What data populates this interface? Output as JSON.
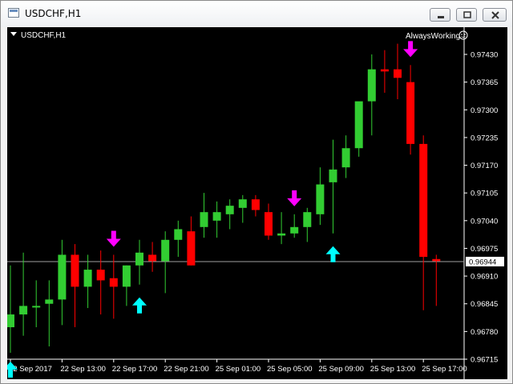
{
  "window": {
    "title": "USDCHF,H1"
  },
  "chart": {
    "symbol_label": "USDCHF,H1",
    "brand_label": "AlwaysWorking"
  },
  "colors": {
    "background": "#000000",
    "bull": "#32cd32",
    "bear": "#ff0000",
    "sell_arrow": "#ff00ff",
    "buy_arrow": "#00ffff",
    "text": "#ffffff"
  },
  "chart_data": {
    "type": "candlestick",
    "symbol": "USDCHF",
    "timeframe": "H1",
    "ylim": [
      0.96715,
      0.97475
    ],
    "y_ticks": [
      "0.97430",
      "0.97365",
      "0.97300",
      "0.97235",
      "0.97170",
      "0.97105",
      "0.97040",
      "0.96975",
      "0.96910",
      "0.96845",
      "0.96780",
      "0.96715"
    ],
    "current_price": "0.96944",
    "x_labels": [
      {
        "label": "22 Sep 2017",
        "candle": 0
      },
      {
        "label": "22 Sep 13:00",
        "candle": 4
      },
      {
        "label": "22 Sep 17:00",
        "candle": 8
      },
      {
        "label": "22 Sep 21:00",
        "candle": 12
      },
      {
        "label": "25 Sep 01:00",
        "candle": 16
      },
      {
        "label": "25 Sep 05:00",
        "candle": 20
      },
      {
        "label": "25 Sep 09:00",
        "candle": 24
      },
      {
        "label": "25 Sep 13:00",
        "candle": 28
      },
      {
        "label": "25 Sep 17:00",
        "candle": 32
      }
    ],
    "candles": [
      {
        "o": 0.9679,
        "h": 0.96935,
        "l": 0.9673,
        "c": 0.9682
      },
      {
        "o": 0.9682,
        "h": 0.96965,
        "l": 0.9677,
        "c": 0.9684
      },
      {
        "o": 0.9684,
        "h": 0.969,
        "l": 0.9679,
        "c": 0.9684
      },
      {
        "o": 0.96845,
        "h": 0.969,
        "l": 0.96745,
        "c": 0.96855
      },
      {
        "o": 0.96855,
        "h": 0.96995,
        "l": 0.96795,
        "c": 0.9696
      },
      {
        "o": 0.9696,
        "h": 0.96985,
        "l": 0.9679,
        "c": 0.96885
      },
      {
        "o": 0.96885,
        "h": 0.9696,
        "l": 0.96835,
        "c": 0.96925
      },
      {
        "o": 0.96925,
        "h": 0.9697,
        "l": 0.9682,
        "c": 0.969
      },
      {
        "o": 0.96905,
        "h": 0.9696,
        "l": 0.9681,
        "c": 0.96885
      },
      {
        "o": 0.96885,
        "h": 0.96935,
        "l": 0.9684,
        "c": 0.96935
      },
      {
        "o": 0.96935,
        "h": 0.96995,
        "l": 0.9689,
        "c": 0.96965
      },
      {
        "o": 0.9696,
        "h": 0.9699,
        "l": 0.9692,
        "c": 0.96945
      },
      {
        "o": 0.96945,
        "h": 0.97015,
        "l": 0.9687,
        "c": 0.96995
      },
      {
        "o": 0.96995,
        "h": 0.9704,
        "l": 0.96955,
        "c": 0.9702
      },
      {
        "o": 0.97015,
        "h": 0.9705,
        "l": 0.96935,
        "c": 0.96935
      },
      {
        "o": 0.97025,
        "h": 0.97105,
        "l": 0.97,
        "c": 0.9706
      },
      {
        "o": 0.9704,
        "h": 0.97085,
        "l": 0.97,
        "c": 0.9706
      },
      {
        "o": 0.97055,
        "h": 0.9709,
        "l": 0.9702,
        "c": 0.97075
      },
      {
        "o": 0.9707,
        "h": 0.971,
        "l": 0.97035,
        "c": 0.9709
      },
      {
        "o": 0.9709,
        "h": 0.971,
        "l": 0.9705,
        "c": 0.97065
      },
      {
        "o": 0.9706,
        "h": 0.9708,
        "l": 0.96995,
        "c": 0.97005
      },
      {
        "o": 0.97005,
        "h": 0.9706,
        "l": 0.96985,
        "c": 0.9701
      },
      {
        "o": 0.9701,
        "h": 0.97055,
        "l": 0.97,
        "c": 0.97025
      },
      {
        "o": 0.97025,
        "h": 0.9707,
        "l": 0.9699,
        "c": 0.9706
      },
      {
        "o": 0.97055,
        "h": 0.97165,
        "l": 0.9703,
        "c": 0.97125
      },
      {
        "o": 0.9713,
        "h": 0.9723,
        "l": 0.9701,
        "c": 0.9716
      },
      {
        "o": 0.97165,
        "h": 0.9724,
        "l": 0.9714,
        "c": 0.9721
      },
      {
        "o": 0.9721,
        "h": 0.9728,
        "l": 0.9719,
        "c": 0.9732
      },
      {
        "o": 0.9732,
        "h": 0.9743,
        "l": 0.9724,
        "c": 0.97395
      },
      {
        "o": 0.97395,
        "h": 0.9744,
        "l": 0.9734,
        "c": 0.9739
      },
      {
        "o": 0.97395,
        "h": 0.97455,
        "l": 0.97325,
        "c": 0.97375
      },
      {
        "o": 0.97365,
        "h": 0.97405,
        "l": 0.97195,
        "c": 0.9722
      },
      {
        "o": 0.9722,
        "h": 0.9724,
        "l": 0.9683,
        "c": 0.96955
      },
      {
        "o": 0.9695,
        "h": 0.9696,
        "l": 0.9684,
        "c": 0.96945
      }
    ],
    "signals": [
      {
        "type": "buy",
        "candle": 0
      },
      {
        "type": "sell",
        "candle": 8
      },
      {
        "type": "buy",
        "candle": 10
      },
      {
        "type": "sell",
        "candle": 22
      },
      {
        "type": "buy",
        "candle": 25
      },
      {
        "type": "sell",
        "candle": 31
      }
    ]
  }
}
